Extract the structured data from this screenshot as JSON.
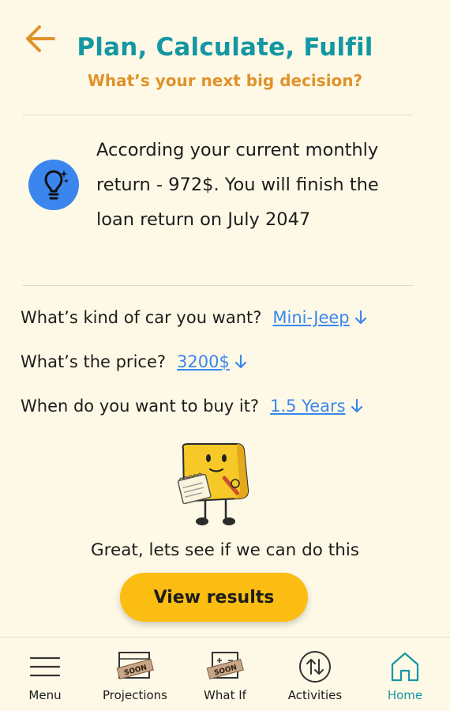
{
  "header": {
    "title": "Plan, Calculate, Fulfil",
    "subtitle": "What’s your next big decision?"
  },
  "tip": {
    "icon": "lightbulb-sparkle-icon",
    "text": "According your current monthly return -  972$. You will finish the loan return on July 2047"
  },
  "questions": [
    {
      "label": "What’s kind of car you want?",
      "value": "Mini-Jeep"
    },
    {
      "label": "What’s the price?",
      "value": "3200$"
    },
    {
      "label": "When do you want to buy it?",
      "value": "1.5 Years"
    }
  ],
  "mascot": {
    "icon": "notepad-mascot-illustration"
  },
  "message": "Great, lets see if we can do this",
  "results_button": "View results",
  "nav": {
    "items": [
      {
        "label": "Menu",
        "icon": "menu-icon"
      },
      {
        "label": "Projections",
        "icon": "projections-icon",
        "badge": "SOON"
      },
      {
        "label": "What If",
        "icon": "what-if-icon",
        "badge": "SOON"
      },
      {
        "label": "Activities",
        "icon": "activities-icon"
      },
      {
        "label": "Home",
        "icon": "home-icon",
        "active": true
      }
    ]
  },
  "colors": {
    "background": "#fdf9e6",
    "title": "#1597a3",
    "subtitle": "#e0922a",
    "link": "#3b86ee",
    "button": "#fbbd12",
    "active_nav": "#1597a3"
  }
}
